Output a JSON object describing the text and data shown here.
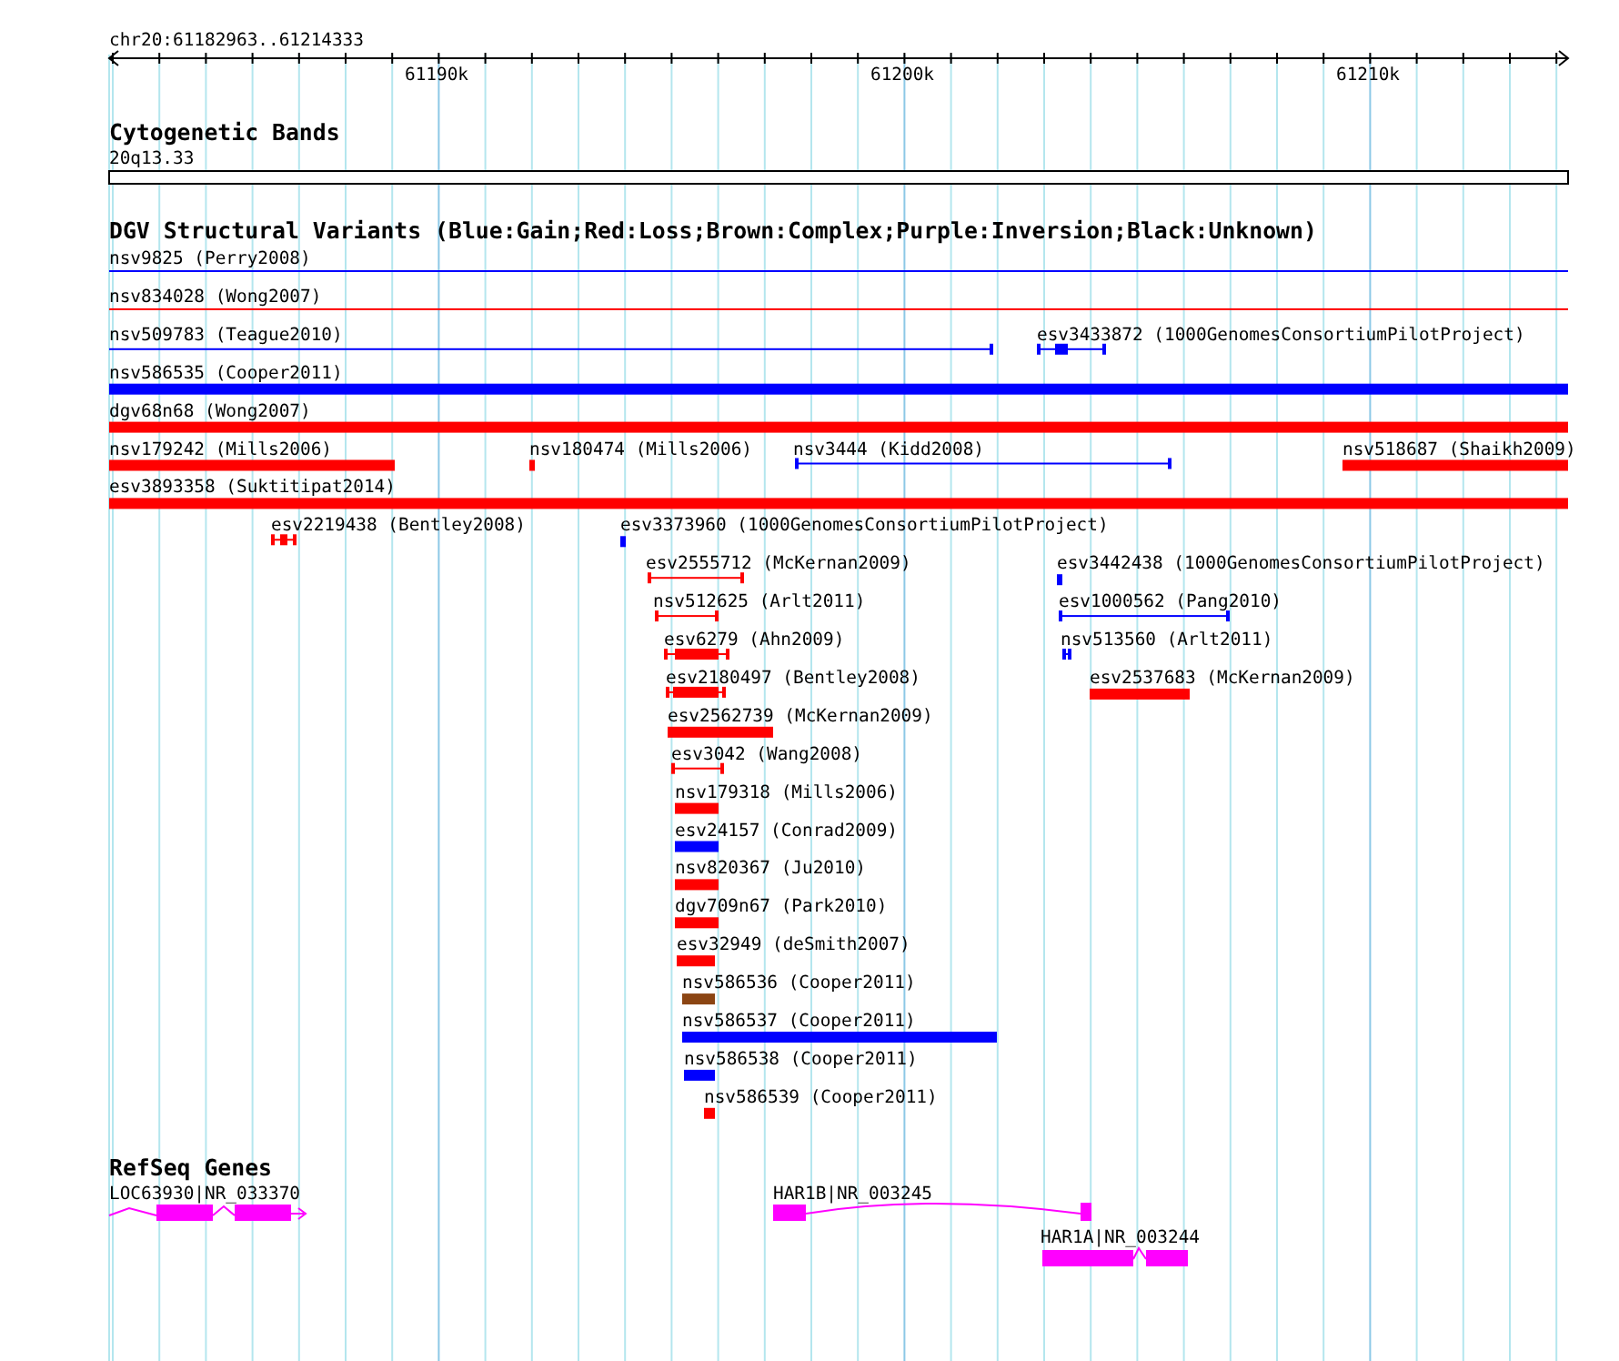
{
  "ruler": {
    "region": "chr20:61182963..61214333",
    "ticks": [
      "61190k",
      "61200k",
      "61210k"
    ]
  },
  "tracks": [
    {
      "title": "Cytogenetic Bands",
      "kind": "bands",
      "features": [
        {
          "label": "20q13.33"
        }
      ]
    },
    {
      "title": "DGV Structural Variants (Blue:Gain;Red:Loss;Brown:Complex;Purple:Inversion;Black:Unknown)",
      "kind": "variants",
      "features": [
        {
          "label": "nsv9825 (Perry2008)",
          "kind": "line",
          "color": "#0000ff"
        },
        {
          "label": "nsv834028 (Wong2007)",
          "kind": "line",
          "color": "#ff0000"
        },
        {
          "label": "nsv509783 (Teague2010)",
          "kind": "bracket",
          "color": "#0000ff"
        },
        {
          "label": "esv3433872 (1000GenomesConsortiumPilotProject)",
          "kind": "bracket-core",
          "color": "#0000ff"
        },
        {
          "label": "nsv586535 (Cooper2011)",
          "kind": "bar",
          "color": "#0000ff"
        },
        {
          "label": "dgv68n68 (Wong2007)",
          "kind": "bar",
          "color": "#ff0000"
        },
        {
          "label": "nsv179242 (Mills2006)",
          "kind": "bar",
          "color": "#ff0000"
        },
        {
          "label": "nsv180474 (Mills2006)",
          "kind": "bar",
          "color": "#ff0000"
        },
        {
          "label": "nsv3444 (Kidd2008)",
          "kind": "bracket",
          "color": "#0000ff"
        },
        {
          "label": "nsv518687 (Shaikh2009)",
          "kind": "bar",
          "color": "#ff0000"
        },
        {
          "label": "esv3893358 (Suktitipat2014)",
          "kind": "bar",
          "color": "#ff0000"
        },
        {
          "label": "esv2219438 (Bentley2008)",
          "kind": "bracket-core",
          "color": "#ff0000"
        },
        {
          "label": "esv3373960 (1000GenomesConsortiumPilotProject)",
          "kind": "bar",
          "color": "#0000ff"
        },
        {
          "label": "esv2555712 (McKernan2009)",
          "kind": "bracket",
          "color": "#ff0000"
        },
        {
          "label": "esv3442438 (1000GenomesConsortiumPilotProject)",
          "kind": "bar",
          "color": "#0000ff"
        },
        {
          "label": "nsv512625 (Arlt2011)",
          "kind": "bracket",
          "color": "#ff0000"
        },
        {
          "label": "esv1000562 (Pang2010)",
          "kind": "bracket",
          "color": "#0000ff"
        },
        {
          "label": "esv6279 (Ahn2009)",
          "kind": "bracket-core",
          "color": "#ff0000"
        },
        {
          "label": "nsv513560 (Arlt2011)",
          "kind": "bracket",
          "color": "#0000ff"
        },
        {
          "label": "esv2180497 (Bentley2008)",
          "kind": "bracket-core",
          "color": "#ff0000"
        },
        {
          "label": "esv2537683 (McKernan2009)",
          "kind": "bar",
          "color": "#ff0000"
        },
        {
          "label": "esv2562739 (McKernan2009)",
          "kind": "bar",
          "color": "#ff0000"
        },
        {
          "label": "esv3042 (Wang2008)",
          "kind": "bracket",
          "color": "#ff0000"
        },
        {
          "label": "nsv179318 (Mills2006)",
          "kind": "bar",
          "color": "#ff0000"
        },
        {
          "label": "esv24157 (Conrad2009)",
          "kind": "bar",
          "color": "#0000ff"
        },
        {
          "label": "nsv820367 (Ju2010)",
          "kind": "bar",
          "color": "#ff0000"
        },
        {
          "label": "dgv709n67 (Park2010)",
          "kind": "bar",
          "color": "#ff0000"
        },
        {
          "label": "esv32949 (deSmith2007)",
          "kind": "bar",
          "color": "#ff0000"
        },
        {
          "label": "nsv586536 (Cooper2011)",
          "kind": "bar",
          "color": "#8b4513"
        },
        {
          "label": "nsv586537 (Cooper2011)",
          "kind": "bar",
          "color": "#0000ff"
        },
        {
          "label": "nsv586538 (Cooper2011)",
          "kind": "bar",
          "color": "#0000ff"
        },
        {
          "label": "nsv586539 (Cooper2011)",
          "kind": "bar",
          "color": "#ff0000"
        }
      ]
    },
    {
      "title": "RefSeq Genes",
      "kind": "genes",
      "features": [
        {
          "label": "LOC63930|NR_033370"
        },
        {
          "label": "HAR1B|NR_003245"
        },
        {
          "label": "HAR1A|NR_003244"
        }
      ]
    }
  ]
}
